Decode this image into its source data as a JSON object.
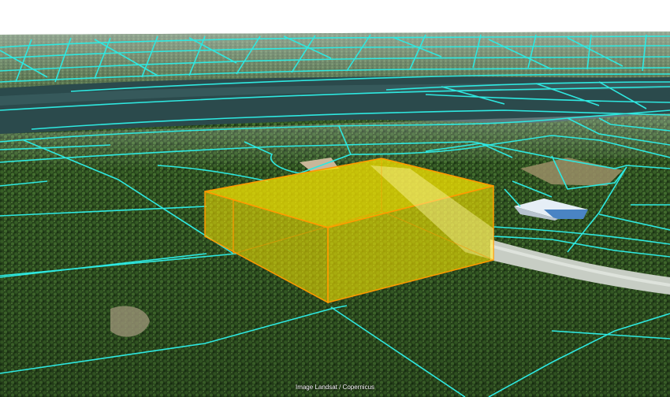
{
  "map": {
    "attribution": "Image Landsat / Copernicus",
    "parcel_line_color": "#2ee8e0",
    "highlight_color": "#f7e400",
    "highlight_edge_color": "#ff9800",
    "layers": [
      "sky",
      "terrain-forest",
      "river",
      "parcel-boundaries",
      "extruded-volume"
    ]
  }
}
